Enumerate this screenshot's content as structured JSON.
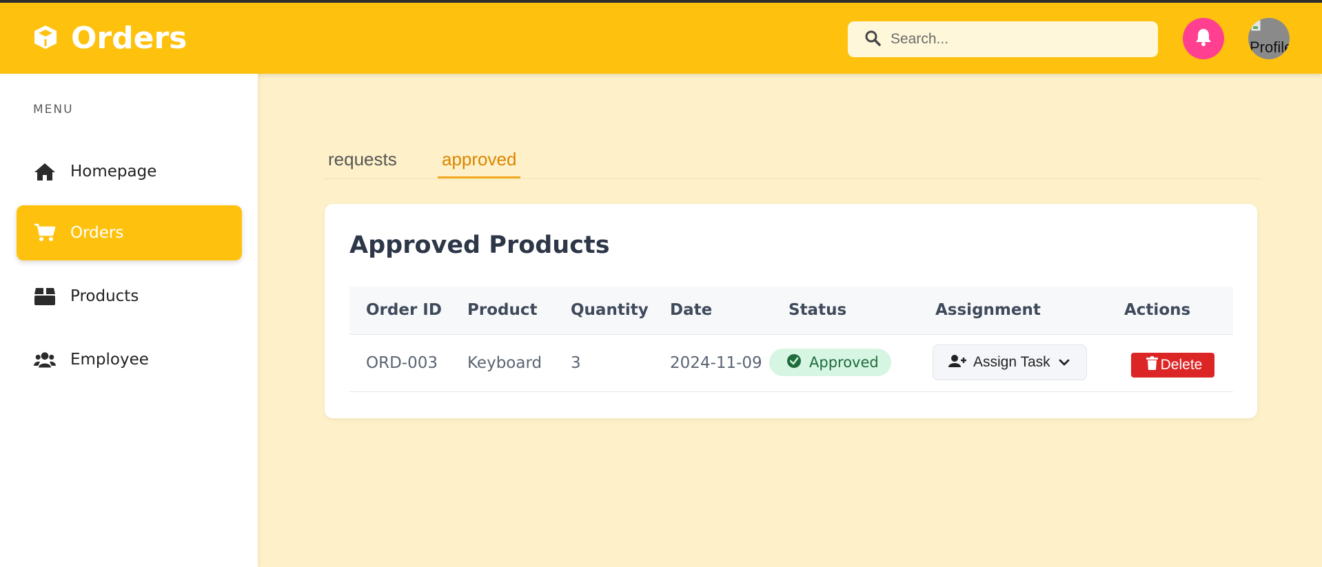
{
  "header": {
    "title": "Orders",
    "logo_icon": "cube-icon",
    "search_placeholder": "Search...",
    "notification_icon": "bell-icon",
    "avatar_alt": "Profile"
  },
  "sidebar": {
    "menu_label": "MENU",
    "items": [
      {
        "label": "Homepage",
        "icon": "home-icon",
        "active": false
      },
      {
        "label": "Orders",
        "icon": "cart-icon",
        "active": true
      },
      {
        "label": "Products",
        "icon": "box-icon",
        "active": false
      },
      {
        "label": "Employee",
        "icon": "users-icon",
        "active": false
      }
    ]
  },
  "tabs": [
    {
      "label": "requests",
      "active": false
    },
    {
      "label": "approved",
      "active": true
    }
  ],
  "card": {
    "title": "Approved Products",
    "columns": [
      "Order ID",
      "Product",
      "Quantity",
      "Date",
      "Status",
      "Assignment",
      "Actions"
    ],
    "rows": [
      {
        "order_id": "ORD-003",
        "product": "Keyboard",
        "quantity": "3",
        "date": "2024-11-09",
        "status": "Approved",
        "assignment_label": "Assign Task",
        "action_label": "Delete"
      }
    ]
  },
  "colors": {
    "brand": "#fec20e",
    "page_background": "#fef1c9",
    "active_tab": "#d98500",
    "notification": "#ff3f8f",
    "status_approved_bg": "#d6f5e3",
    "status_approved_text": "#1f6b3c",
    "delete": "#dc2626"
  }
}
